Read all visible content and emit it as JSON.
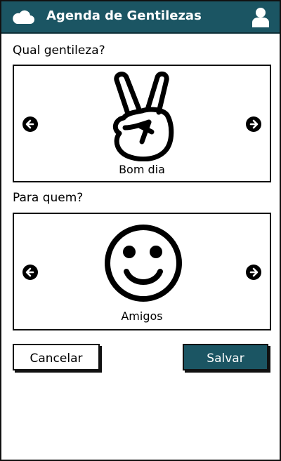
{
  "header": {
    "title": "Agenda de Gentilezas",
    "icons": {
      "left": "cloud-icon",
      "right": "user-icon"
    },
    "bg_color": "#1b5563"
  },
  "kindness": {
    "label": "Qual gentileza?",
    "caption": "Bom dia",
    "icon": "peace-hand-icon"
  },
  "recipient": {
    "label": "Para quem?",
    "caption": "Amigos",
    "icon": "smiley-face-icon"
  },
  "actions": {
    "cancel_label": "Cancelar",
    "save_label": "Salvar"
  }
}
